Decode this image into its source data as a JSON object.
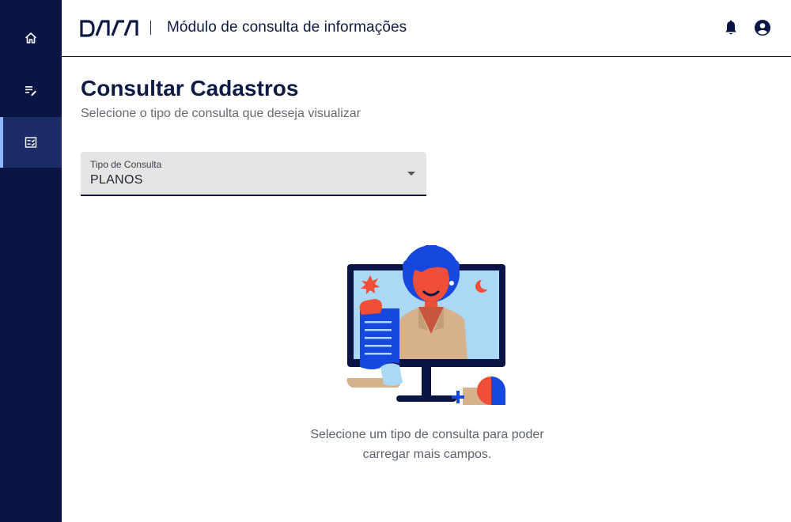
{
  "sidebar": {
    "items": [
      {
        "name": "home",
        "icon": "home-icon",
        "active": false
      },
      {
        "name": "edit-list",
        "icon": "list-edit-icon",
        "active": false
      },
      {
        "name": "consult",
        "icon": "checklist-icon",
        "active": true
      }
    ]
  },
  "header": {
    "logo_text": "DASA",
    "app_title": "Módulo de consulta de informações",
    "icons": [
      "bell-icon",
      "account-circle-icon"
    ]
  },
  "main": {
    "title": "Consultar Cadastros",
    "subtitle": "Selecione o tipo de consulta que deseja visualizar",
    "select": {
      "label": "Tipo de Consulta",
      "value": "PLANOS"
    },
    "empty_state": {
      "line1": "Selecione um tipo de consulta para poder",
      "line2": "carregar mais campos."
    }
  },
  "colors": {
    "navy": "#0a1545",
    "accent_blue": "#1648e0",
    "coral": "#f04e37",
    "screen": "#aad8f5",
    "tan": "#d6b28c"
  }
}
